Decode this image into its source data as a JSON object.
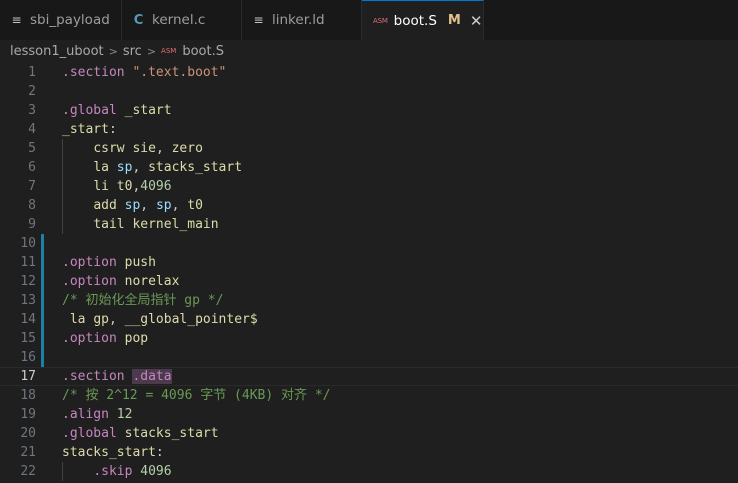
{
  "tabs": [
    {
      "label": "sbi_payload",
      "icon": "lines-icon"
    },
    {
      "label": "kernel.c",
      "icon": "c-language-icon",
      "glyph": "C"
    },
    {
      "label": "linker.ld",
      "icon": "lines-icon"
    },
    {
      "label": "boot.S",
      "icon": "asm-file-icon",
      "glyph": "ASM",
      "modified": "M",
      "close": "✕"
    }
  ],
  "breadcrumb": {
    "items": [
      "lesson1_uboot",
      "src",
      "boot.S"
    ],
    "asm_glyph": "ASM"
  },
  "editor": {
    "current_line": 17,
    "lines": [
      {
        "n": "1",
        "html": "<span class=\"kw\">.section</span> <span class=\"str\">\".text.boot\"</span>"
      },
      {
        "n": "2",
        "html": ""
      },
      {
        "n": "3",
        "html": "<span class=\"kw\">.global</span> <span class=\"fn\">_start</span>"
      },
      {
        "n": "4",
        "html": "<span class=\"fn\">_start</span>:"
      },
      {
        "n": "5",
        "html": "    <span class=\"fn\">csrw</span> <span class=\"fn\">sie</span>, <span class=\"fn\">zero</span>"
      },
      {
        "n": "6",
        "html": "    <span class=\"fn\">la</span> <span class=\"reg\">sp</span>, <span class=\"fn\">stacks_start</span>"
      },
      {
        "n": "7",
        "html": "    <span class=\"fn\">li</span> <span class=\"fn\">t0</span>,<span class=\"num\">4096</span>"
      },
      {
        "n": "8",
        "html": "    <span class=\"fn\">add</span> <span class=\"reg\">sp</span>, <span class=\"reg\">sp</span>, <span class=\"fn\">t0</span>"
      },
      {
        "n": "9",
        "html": "    <span class=\"fn\">tail</span> <span class=\"fn\">kernel_main</span>"
      },
      {
        "n": "10",
        "html": "",
        "modified": true
      },
      {
        "n": "11",
        "html": "<span class=\"kw\">.option</span> <span class=\"fn\">push</span>",
        "modified": true
      },
      {
        "n": "12",
        "html": "<span class=\"kw\">.option</span> <span class=\"fn\">norelax</span>",
        "modified": true
      },
      {
        "n": "13",
        "html": "<span class=\"cm\">/* 初始化全局指针 gp */</span>",
        "modified": true
      },
      {
        "n": "14",
        "html": " <span class=\"fn\">la</span> <span class=\"fn\">gp</span>, <span class=\"fn\">__global_pointer$</span>",
        "modified": true
      },
      {
        "n": "15",
        "html": "<span class=\"kw\">.option</span> <span class=\"fn\">pop</span>",
        "modified": true
      },
      {
        "n": "16",
        "html": "",
        "modified": true
      },
      {
        "n": "17",
        "html": "<span class=\"kw\">.section</span> <span class=\"kw hl\">.data</span>"
      },
      {
        "n": "18",
        "html": "<span class=\"cm\">/* 按 2^12 = 4096 字节 (4KB) 对齐 */</span>"
      },
      {
        "n": "19",
        "html": "<span class=\"kw\">.align</span> <span class=\"num\">12</span>"
      },
      {
        "n": "20",
        "html": "<span class=\"kw\">.global</span> <span class=\"fn\">stacks_start</span>"
      },
      {
        "n": "21",
        "html": "<span class=\"fn\">stacks_start</span>:"
      },
      {
        "n": "22",
        "html": "    <span class=\"kw\">.skip</span> <span class=\"num\">4096</span>"
      }
    ]
  }
}
